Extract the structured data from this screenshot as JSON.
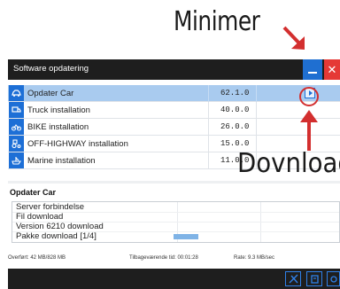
{
  "annotations": {
    "top_label": "Minimer",
    "bottom_label": "Dovnload"
  },
  "window": {
    "title": "Software opdatering",
    "close_glyph": "✕",
    "accent_color": "#1d6fd6",
    "close_color": "#e53935"
  },
  "packages": [
    {
      "name": "Opdater Car",
      "version": "62.1.0",
      "icon": "car-icon",
      "selected": true
    },
    {
      "name": "Truck  installation",
      "version": "40.0.0",
      "icon": "truck-icon",
      "selected": false
    },
    {
      "name": "BIKE  installation",
      "version": "26.0.0",
      "icon": "bike-icon",
      "selected": false
    },
    {
      "name": "OFF-HIGHWAY  installation",
      "version": "15.0.0",
      "icon": "tractor-icon",
      "selected": false
    },
    {
      "name": "Marine  installation",
      "version": "11.0.0",
      "icon": "boat-icon",
      "selected": false
    }
  ],
  "detail": {
    "title": "Opdater Car",
    "log": [
      "Server forbindelse",
      "Fil download",
      "Version 6210 download",
      "Pakke download  [1/4]"
    ],
    "progress_fraction": 0.1
  },
  "footer": {
    "transferred": "Overført: 42 MB/828 MB",
    "remaining": "Tilbageværende tid: 00:01:28",
    "rate": "Rate: 9.3 MB/sec"
  },
  "toolbar_icons": [
    "tools-icon",
    "panel-icon",
    "car-settings-icon"
  ]
}
